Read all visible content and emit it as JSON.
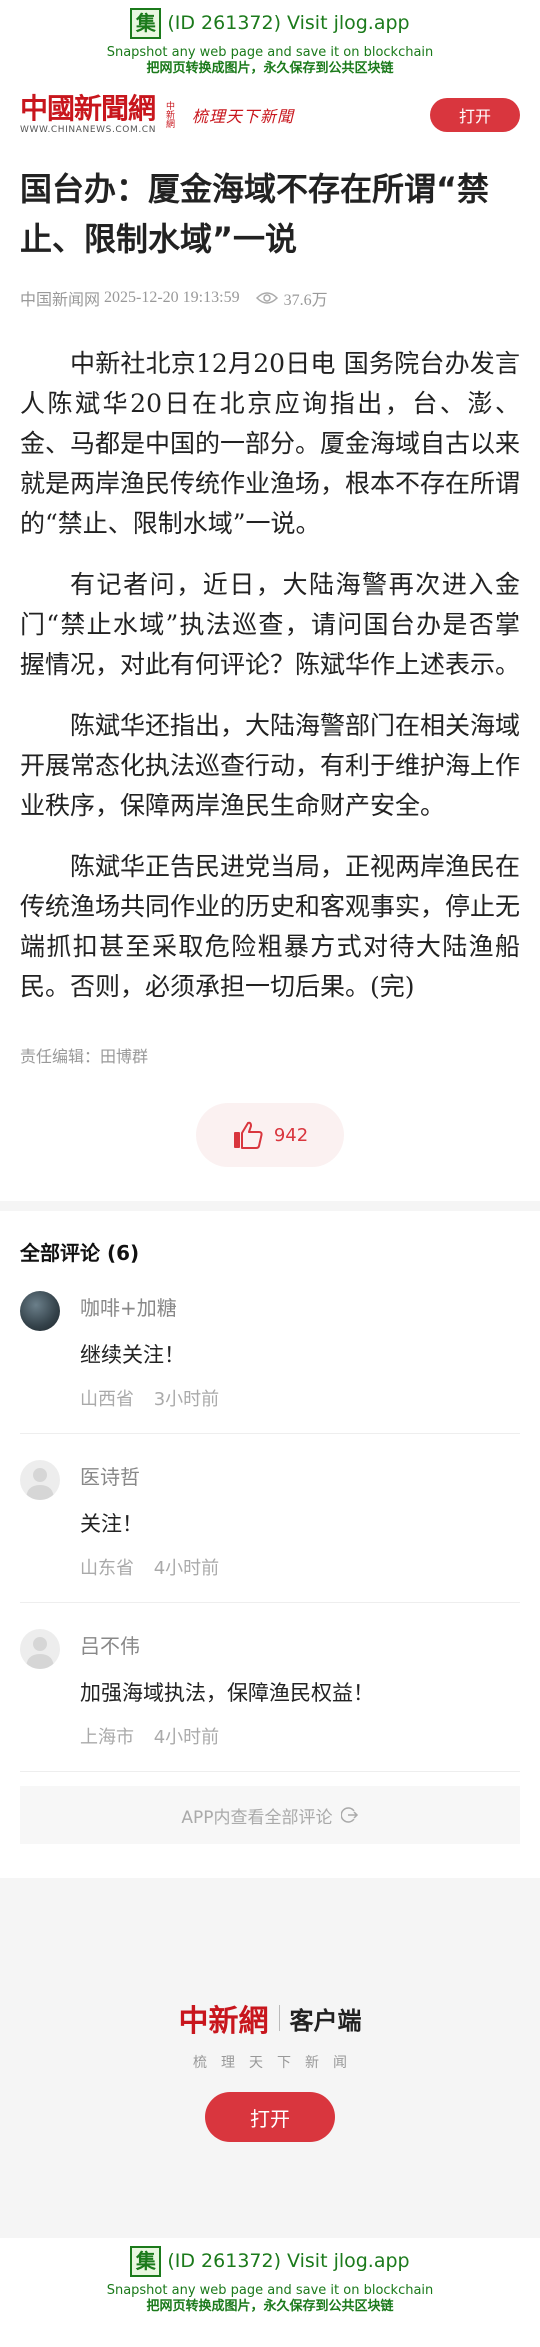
{
  "jlog": {
    "badge": "集",
    "line1": "(ID 261372) Visit jlog.app",
    "line2": "Snapshot any web page and save it on blockchain",
    "line3": "把网页转换成图片，永久保存到公共区块链"
  },
  "header": {
    "logo_text": "中國新聞網",
    "logo_sub": "中新網",
    "logo_url": "WWW.CHINANEWS.COM.CN",
    "slogan": "梳理天下新聞",
    "open_label": "打开"
  },
  "article": {
    "title": "国台办：厦金海域不存在所谓“禁止、限制水域”一说",
    "source": "中国新闻网",
    "datetime": "2025-12-20 19:13:59",
    "views": "37.6万",
    "paragraphs": [
      "中新社北京12月20日电 国务院台办发言人陈斌华20日在北京应询指出，台、澎、金、马都是中国的一部分。厦金海域自古以来就是两岸渔民传统作业渔场，根本不存在所谓的“禁止、限制水域”一说。",
      "有记者问，近日，大陆海警再次进入金门“禁止水域”执法巡查，请问国台办是否掌握情况，对此有何评论？陈斌华作上述表示。",
      "陈斌华还指出，大陆海警部门在相关海域开展常态化执法巡查行动，有利于维护海上作业秩序，保障两岸渔民生命财产安全。",
      "陈斌华正告民进党当局，正视两岸渔民在传统渔场共同作业的历史和客观事实，停止无端抓扣甚至采取危险粗暴方式对待大陆渔船民。否则，必须承担一切后果。(完)"
    ],
    "editor": "责任编辑：田博群",
    "likes": "942"
  },
  "comments": {
    "heading": "全部评论 (6)",
    "items": [
      {
        "name": "咖啡+加糖",
        "text": "继续关注！",
        "location": "山西省",
        "time": "3小时前",
        "avatar": "photo"
      },
      {
        "name": "医诗哲",
        "text": "关注！",
        "location": "山东省",
        "time": "4小时前",
        "avatar": "default"
      },
      {
        "name": "吕不伟",
        "text": "加强海域执法，保障渔民权益！",
        "location": "上海市",
        "time": "4小时前",
        "avatar": "default"
      }
    ],
    "view_all": "APP内查看全部评论"
  },
  "promo": {
    "brand": "中新網",
    "client": "客户端",
    "slogan": "梳理天下新闻",
    "open_label": "打开"
  },
  "colors": {
    "brand_red": "#c8161d",
    "button_red": "#d9363e",
    "jlog_green": "#1b7a1b"
  }
}
